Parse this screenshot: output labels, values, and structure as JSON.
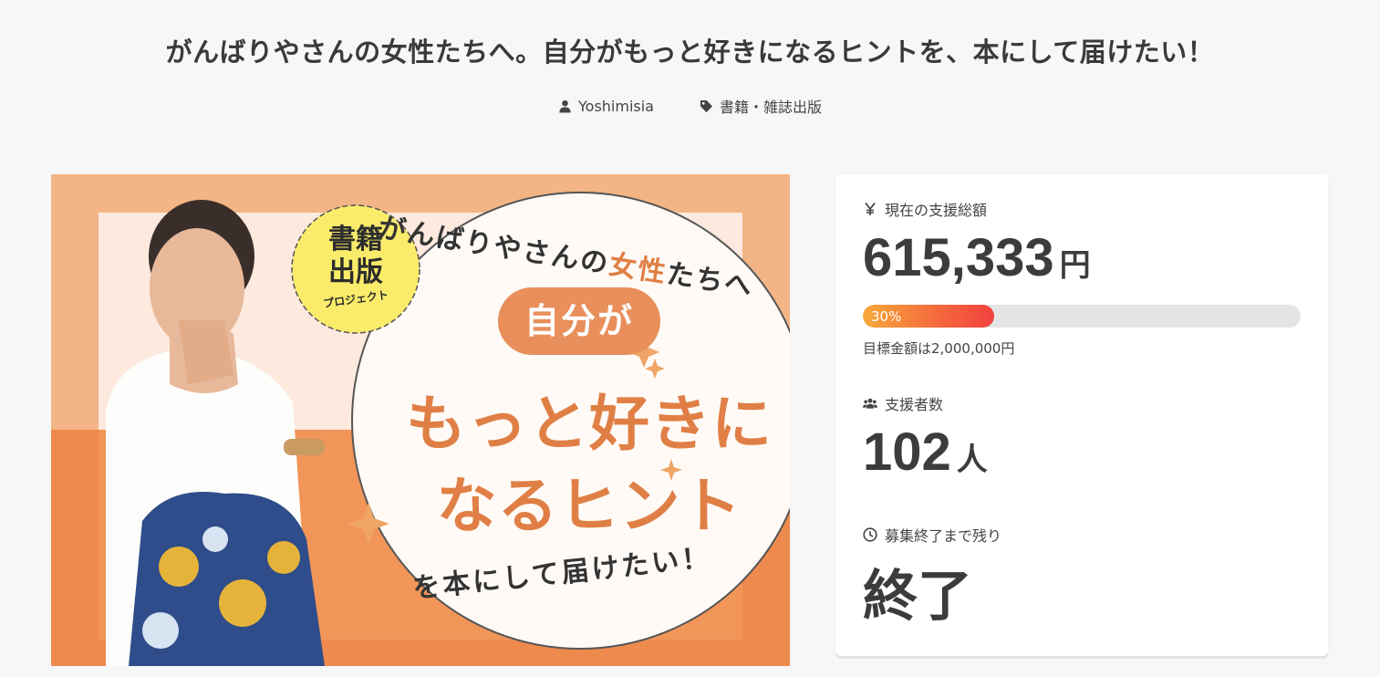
{
  "page": {
    "title": "がんばりやさんの女性たちへ。自分がもっと好きになるヒントを、本にして届けたい！"
  },
  "meta": {
    "author": "Yoshimisia",
    "category": "書籍・雑誌出版",
    "author_icon": "user-icon",
    "category_icon": "tag-icon"
  },
  "hero": {
    "badge_line1": "書籍",
    "badge_line2": "出版",
    "badge_sub": "プロジェクト",
    "arc_top_a": "がんばりやさんの",
    "arc_top_b": "女性",
    "arc_top_c": "たちへ",
    "bubble": "自分が",
    "line1": "もっと好きに",
    "line2": "なるヒント",
    "arc_bottom": "を本にして届けたい！"
  },
  "stats": {
    "amount_label": "現在の支援総額",
    "amount_value": "615,333",
    "amount_unit": "円",
    "progress_percent": 30,
    "progress_label": "30%",
    "goal_text": "目標金額は2,000,000円",
    "backers_label": "支援者数",
    "backers_value": "102",
    "backers_unit": "人",
    "remaining_label": "募集終了まで残り",
    "remaining_value": "終了"
  },
  "colors": {
    "accent_orange": "#e07f45",
    "progress_start": "#f7a93a",
    "progress_end": "#f2413f",
    "background": "#f6f7f8"
  }
}
